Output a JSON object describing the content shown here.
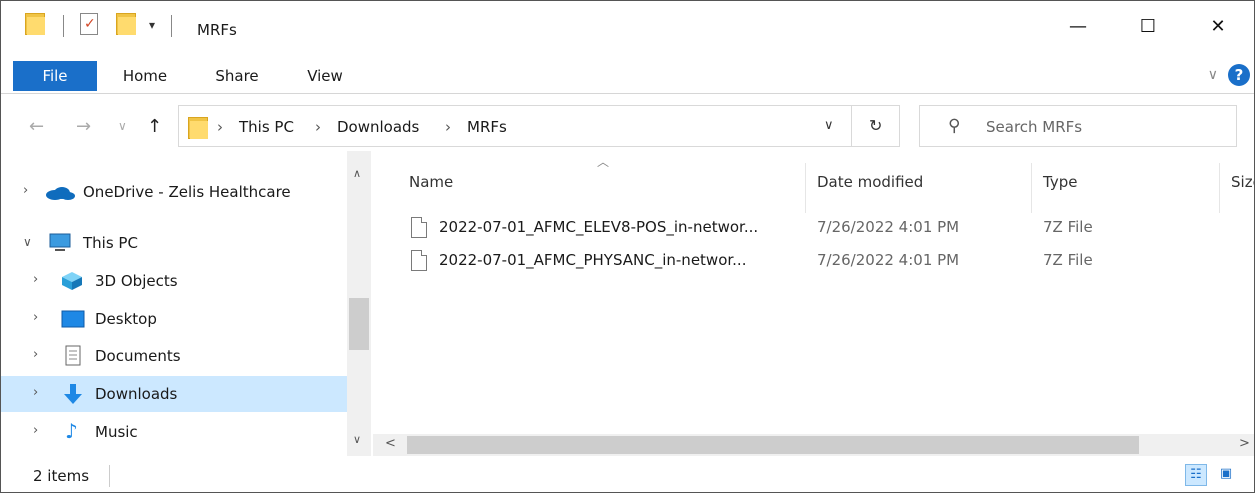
{
  "window": {
    "title": "MRFs",
    "controls": {
      "minimize": "—",
      "maximize": "☐",
      "close": "✕"
    }
  },
  "ribbon": {
    "tabs": [
      "File",
      "Home",
      "Share",
      "View"
    ],
    "expand_icon": "chevron-down-icon",
    "help_label": "?"
  },
  "address": {
    "breadcrumbs": [
      "This PC",
      "Downloads",
      "MRFs"
    ],
    "separator": "›"
  },
  "search": {
    "placeholder": "Search MRFs"
  },
  "nav_pane": {
    "items": [
      {
        "label": "OneDrive - Zelis Healthcare",
        "icon": "onedrive-cloud-icon",
        "expanded": false,
        "selected": false
      },
      {
        "label": "This PC",
        "icon": "pc-icon",
        "expanded": true,
        "selected": false
      },
      {
        "label": "3D Objects",
        "icon": "3d-objects-icon",
        "expanded": false,
        "selected": false
      },
      {
        "label": "Desktop",
        "icon": "desktop-icon",
        "expanded": false,
        "selected": false
      },
      {
        "label": "Documents",
        "icon": "documents-icon",
        "expanded": false,
        "selected": false
      },
      {
        "label": "Downloads",
        "icon": "downloads-icon",
        "expanded": false,
        "selected": true
      },
      {
        "label": "Music",
        "icon": "music-icon",
        "expanded": false,
        "selected": false
      }
    ]
  },
  "file_list": {
    "columns": [
      "Name",
      "Date modified",
      "Type",
      "Size"
    ],
    "sorted_by": "Name",
    "rows": [
      {
        "name": "2022-07-01_AFMC_ELEV8-POS_in-networ...",
        "date": "7/26/2022 4:01 PM",
        "type": "7Z File"
      },
      {
        "name": "2022-07-01_AFMC_PHYSANC_in-networ...",
        "date": "7/26/2022 4:01 PM",
        "type": "7Z File"
      }
    ]
  },
  "status_bar": {
    "item_count": "2 items",
    "view": "details"
  },
  "colors": {
    "accent": "#1a6fc9",
    "selection": "#cce8ff",
    "folder": "#ffdb6e"
  }
}
